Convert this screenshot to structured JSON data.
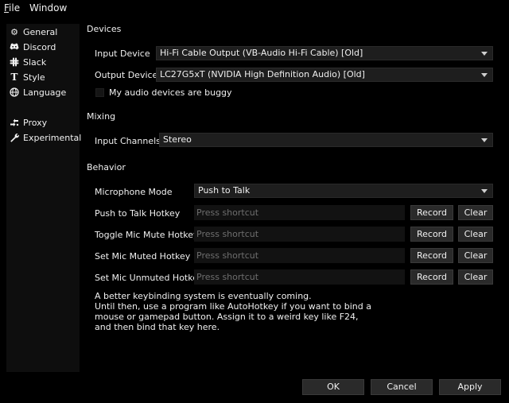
{
  "menubar": {
    "file": "File",
    "file_accel": "F",
    "file_rest": "ile",
    "window": "Window"
  },
  "sidebar": {
    "items": [
      {
        "label": "General",
        "icon": "gear-icon"
      },
      {
        "label": "Discord",
        "icon": "discord-icon"
      },
      {
        "label": "Slack",
        "icon": "slack-icon"
      },
      {
        "label": "Style",
        "icon": "text-style-icon"
      },
      {
        "label": "Language",
        "icon": "globe-icon"
      },
      {
        "label": "Proxy",
        "icon": "proxy-icon"
      },
      {
        "label": "Experimental",
        "icon": "wrench-icon"
      }
    ]
  },
  "devices": {
    "title": "Devices",
    "input_label": "Input Device",
    "input_value": "Hi-Fi Cable Output (VB-Audio Hi-Fi Cable) [Old]",
    "output_label": "Output Device",
    "output_value": "LC27G5xT (NVIDIA High Definition Audio) [Old]",
    "buggy_label": "My audio devices are buggy"
  },
  "mixing": {
    "title": "Mixing",
    "channels_label": "Input Channels",
    "channels_value": "Stereo"
  },
  "behavior": {
    "title": "Behavior",
    "mic_mode_label": "Microphone Mode",
    "mic_mode_value": "Push to Talk",
    "hotkeys": [
      {
        "label": "Push to Talk Hotkey",
        "placeholder": "Press shortcut",
        "record": "Record",
        "clear": "Clear"
      },
      {
        "label": "Toggle Mic Mute Hotkey",
        "placeholder": "Press shortcut",
        "record": "Record",
        "clear": "Clear"
      },
      {
        "label": "Set Mic Muted Hotkey",
        "placeholder": "Press shortcut",
        "record": "Record",
        "clear": "Clear"
      },
      {
        "label": "Set Mic Unmuted Hotkey",
        "placeholder": "Press shortcut",
        "record": "Record",
        "clear": "Clear"
      }
    ],
    "note_lines": [
      "A better keybinding system is eventually coming.",
      "Until then, use a program like AutoHotkey if you want to bind a",
      "mouse or gamepad button. Assign it to a weird key like F24,",
      "and then bind that key here."
    ]
  },
  "footer": {
    "ok": "OK",
    "cancel": "Cancel",
    "apply": "Apply"
  }
}
